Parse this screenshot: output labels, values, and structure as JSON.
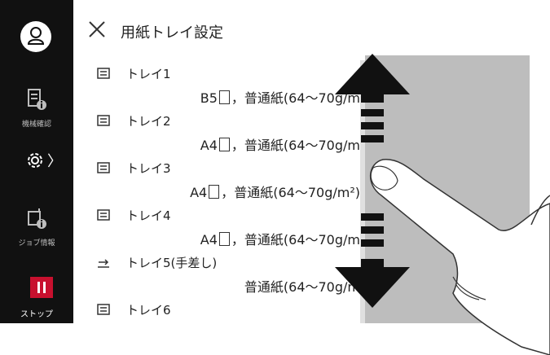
{
  "header": {
    "title": "用紙トレイ設定"
  },
  "sidebar": {
    "machine_label": "機械確認",
    "job_label": "ジョブ情報",
    "stop_label": "ストップ",
    "gear_chevron": "〉"
  },
  "trays": [
    {
      "name": "トレイ1",
      "size": "B5",
      "type": "普通紙(64〜70g/m",
      "icon": "tray-icon"
    },
    {
      "name": "トレイ2",
      "size": "A4",
      "type": "普通紙(64〜70g/m",
      "icon": "tray-icon"
    },
    {
      "name": "トレイ3",
      "size": "A4",
      "type": "普通紙(64〜70g/m²)",
      "icon": "tray-icon"
    },
    {
      "name": "トレイ4",
      "size": "A4",
      "type": "普通紙(64〜70g/m",
      "icon": "tray-icon"
    },
    {
      "name": "トレイ5(手差し)",
      "size": "",
      "type": "普通紙(64〜70g/m",
      "icon": "bypass-tray-icon"
    },
    {
      "name": "トレイ6",
      "size": "",
      "type": "",
      "icon": "tray-icon"
    }
  ],
  "separator": "，",
  "colors": {
    "sidebar": "#111111",
    "stop": "#c8102e",
    "pane": "#bdbdbd"
  }
}
